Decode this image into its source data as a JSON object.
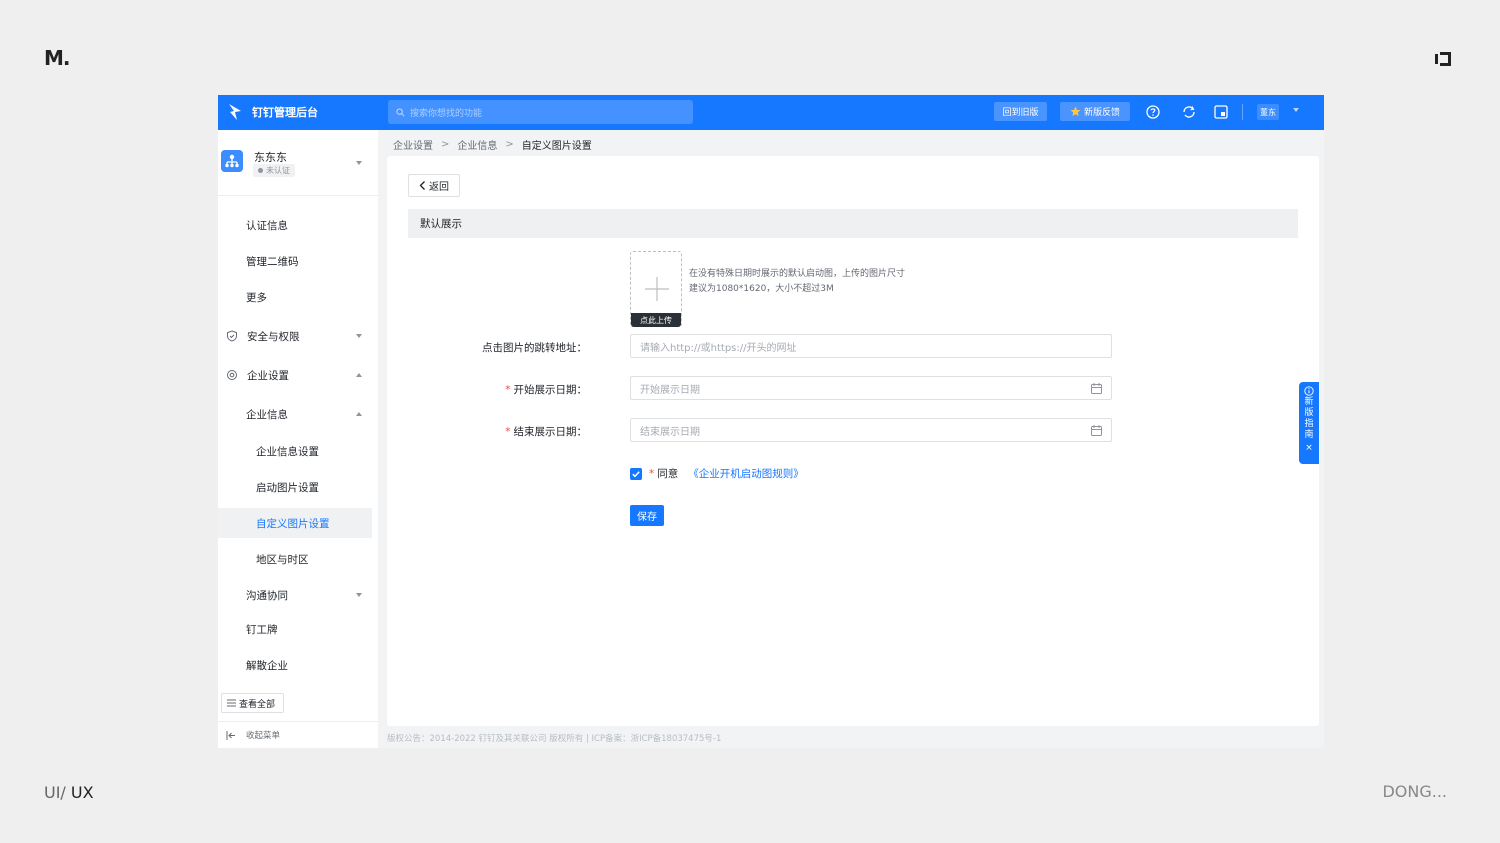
{
  "frame": {
    "brand_mark": "M.",
    "footer_left_prefix": "UI/",
    "footer_left_strong": "UX",
    "footer_right": "DONG..."
  },
  "topbar": {
    "app_title": "钉钉管理后台",
    "search_placeholder": "搜索你想找的功能",
    "old_version_button": "回到旧版",
    "feedback_button": "新版反馈",
    "user_tag": "董东",
    "accent_color": "#1677ff"
  },
  "sidebar": {
    "org_name": "东东东",
    "org_status": "未认证",
    "items": {
      "cert_info": "认证信息",
      "qr_code": "管理二维码",
      "more": "更多",
      "security": "安全与权限",
      "enterprise_settings": "企业设置",
      "enterprise_info": "企业信息",
      "enterprise_info_settings": "企业信息设置",
      "startup_image_settings": "启动图片设置",
      "custom_image_settings": "自定义图片设置",
      "region_timezone": "地区与时区",
      "communication": "沟通协同",
      "badge": "钉工牌",
      "dissolve": "解散企业"
    },
    "view_all": "查看全部",
    "collapse_menu": "收起菜单"
  },
  "breadcrumb": {
    "level1": "企业设置",
    "level2": "企业信息",
    "current": "自定义图片设置"
  },
  "main": {
    "back_button": "返回",
    "section_title": "默认展示",
    "upload_label": "点此上传",
    "upload_hint": "在没有特殊日期时展示的默认启动图，上传的图片尺寸建议为1080*1620，大小不超过3M",
    "link_label": "点击图片的跳转地址：",
    "link_placeholder": "请输入http://或https://开头的网址",
    "start_label": "开始展示日期：",
    "start_placeholder": "开始展示日期",
    "end_label": "结束展示日期：",
    "end_placeholder": "结束展示日期",
    "required_mark": "*",
    "agree_text": "同意",
    "agree_link": "《企业开机启动图规则》",
    "agree_checked": true,
    "save_button": "保存"
  },
  "copyright": "版权公告：2014-2022 钉钉及其关联公司 版权所有 | ICP备案：浙ICP备18037475号-1",
  "float_guide": {
    "chars": [
      "新",
      "版",
      "指",
      "南"
    ]
  }
}
